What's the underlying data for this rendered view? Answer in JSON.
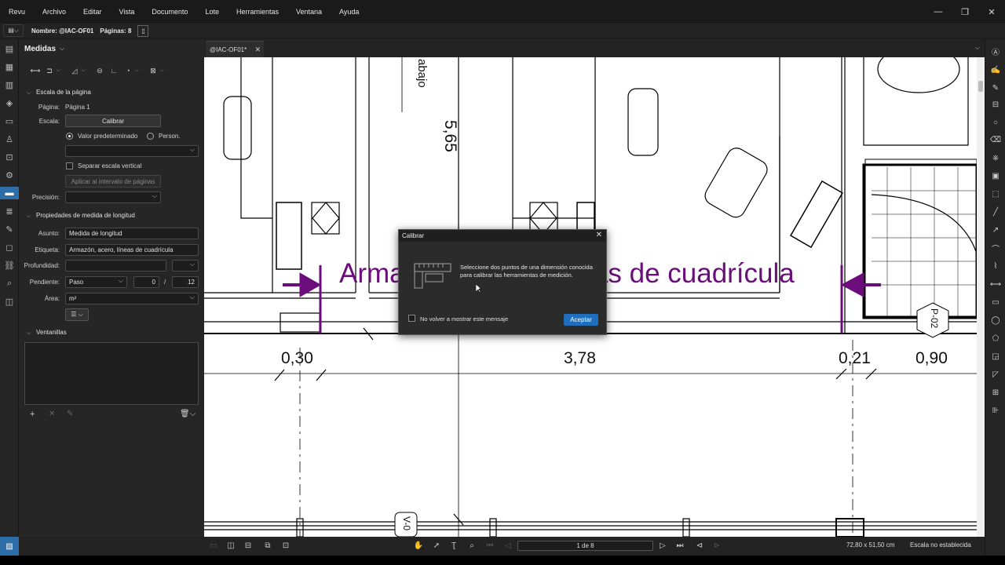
{
  "menu": [
    "Revu",
    "Archivo",
    "Editar",
    "Vista",
    "Documento",
    "Lote",
    "Herramientas",
    "Ventana",
    "Ayuda"
  ],
  "docbar": {
    "name": "Nombre: @IAC-OF01",
    "pages": "Páginas: 8"
  },
  "tab": {
    "label": "@IAC-OF01*"
  },
  "panel": {
    "title": "Medidas",
    "scale_section": "Escala de la página",
    "page_label": "Página:",
    "page_value": "Página 1",
    "scale_label": "Escala:",
    "calibrate_btn": "Calibrar",
    "radio_default": "Valor predeterminado",
    "radio_custom": "Person.",
    "separate_vertical": "Separar escala vertical",
    "apply_range_btn": "Aplicar al intervalo de páginas",
    "precision_label": "Precisión:",
    "length_section": "Propiedades de medida de longitud",
    "subject_label": "Asunto:",
    "subject_value": "Medida de longitud",
    "tag_label": "Etiqueta:",
    "tag_value": "Armazón, acero, líneas de cuadrícula",
    "depth_label": "Profundidad:",
    "slope_label": "Pendiente:",
    "slope_value": "Paso",
    "slope_num": "0",
    "slope_sep": "/",
    "slope_den": "12",
    "area_label": "Área:",
    "area_value": "m²",
    "windows_section": "Ventanillas"
  },
  "drawing": {
    "label_text": "Armazón, acero, líneas de cuadrícula",
    "dim_030": "0,30",
    "dim_378": "3,78",
    "dim_021": "0,21",
    "dim_090": "0,90",
    "dim_565": "5,65",
    "abajo": "abajo",
    "tag_p02": "P-02",
    "tag_v0": "V-0"
  },
  "dialog": {
    "title": "Calibrar",
    "message": "Seleccione dos puntos de una dimensión conocida para calibrar las herramientas de medición.",
    "checkbox_label": "No volver a mostrar este mensaje",
    "ok_label": "Aceptar"
  },
  "statusbar": {
    "page_box": "1 de 8",
    "dimensions": "72,80 x 51,50 cm",
    "scale": "Escala no establecida"
  },
  "colors": {
    "accent": "#2d6ea8",
    "markup": "#6b0d7a",
    "ok_button": "#1f6fbe"
  }
}
